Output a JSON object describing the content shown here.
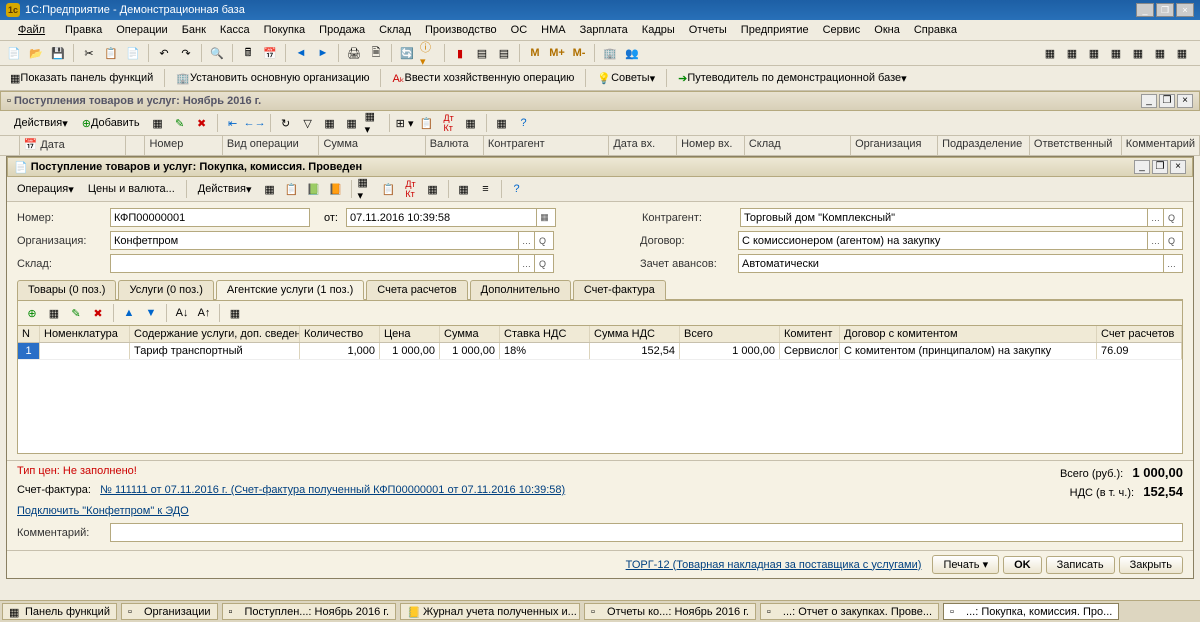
{
  "app_title": "1С:Предприятие - Демонстрационная база",
  "menu": [
    "Файл",
    "Правка",
    "Операции",
    "Банк",
    "Касса",
    "Покупка",
    "Продажа",
    "Склад",
    "Производство",
    "ОС",
    "НМА",
    "Зарплата",
    "Кадры",
    "Отчеты",
    "Предприятие",
    "Сервис",
    "Окна",
    "Справка"
  ],
  "toolbar2": {
    "show_panel": "Показать панель функций",
    "set_org": "Установить основную организацию",
    "enter_op": "Ввести хозяйственную операцию",
    "advice": "Советы",
    "guide": "Путеводитель по демонстрационной базе"
  },
  "list_title": "Поступления товаров и услуг: Ноябрь 2016 г.",
  "list_toolbar": {
    "actions": "Действия",
    "add": "Добавить"
  },
  "list_cols": [
    "",
    "Дата",
    "",
    "Номер",
    "Вид операции",
    "Сумма",
    "Валюта",
    "Контрагент",
    "Дата вх.",
    "Номер вх.",
    "Склад",
    "Организация",
    "Подразделение",
    "Ответственный",
    "Комментарий"
  ],
  "doc_title": "Поступление товаров и услуг: Покупка, комиссия. Проведен",
  "doc_toolbar": {
    "operation": "Операция",
    "prices": "Цены и валюта...",
    "actions": "Действия"
  },
  "form": {
    "number_lbl": "Номер:",
    "number": "КФП00000001",
    "from_lbl": "от:",
    "date": "07.11.2016 10:39:58",
    "org_lbl": "Организация:",
    "org": "Конфетпром",
    "warehouse_lbl": "Склад:",
    "warehouse": "",
    "contr_lbl": "Контрагент:",
    "contr": "Торговый дом \"Комплексный\"",
    "contract_lbl": "Договор:",
    "contract": "С комиссионером (агентом) на закупку",
    "advance_lbl": "Зачет авансов:",
    "advance": "Автоматически"
  },
  "tabs": [
    "Товары (0 поз.)",
    "Услуги (0 поз.)",
    "Агентские услуги (1 поз.)",
    "Счета расчетов",
    "Дополнительно",
    "Счет-фактура"
  ],
  "active_tab": 2,
  "grid_cols": [
    "N",
    "Номенклатура",
    "Содержание услуги, доп. сведения",
    "Количество",
    "Цена",
    "Сумма",
    "Ставка НДС",
    "Сумма НДС",
    "Всего",
    "Комитент",
    "Договор с комитентом",
    "Счет расчетов"
  ],
  "grid_row": {
    "n": "1",
    "nomen": "",
    "desc": "Тариф транспортный",
    "qty": "1,000",
    "price": "1 000,00",
    "sum": "1 000,00",
    "vat": "18%",
    "vat_sum": "152,54",
    "total": "1 000,00",
    "komitent": "Сервислог",
    "contract": "С комитентом (принципалом) на закупку",
    "acct": "76.09"
  },
  "footer": {
    "price_type": "Тип цен: Не заполнено!",
    "sf_lbl": "Счет-фактура:",
    "sf": "№ 111111 от 07.11.2016 г. (Счет-фактура полученный КФП00000001 от 07.11.2016 10:39:58)",
    "edo": "Подключить \"Конфетпром\" к ЭДО",
    "comment_lbl": "Комментарий:",
    "total_lbl": "Всего (руб.):",
    "total": "1 000,00",
    "vat_lbl": "НДС (в т. ч.):",
    "vat": "152,54"
  },
  "bottom": {
    "torg": "ТОРГ-12 (Товарная накладная за поставщика с услугами)",
    "print": "Печать",
    "ok": "OK",
    "save": "Записать",
    "close": "Закрыть"
  },
  "taskbar": [
    "Панель функций",
    "Организации",
    "Поступлен...: Ноябрь 2016 г.",
    "Журнал учета полученных и...",
    "Отчеты ко...: Ноябрь 2016 г.",
    "...: Отчет о закупках. Прове...",
    "...: Покупка, комиссия. Про..."
  ]
}
